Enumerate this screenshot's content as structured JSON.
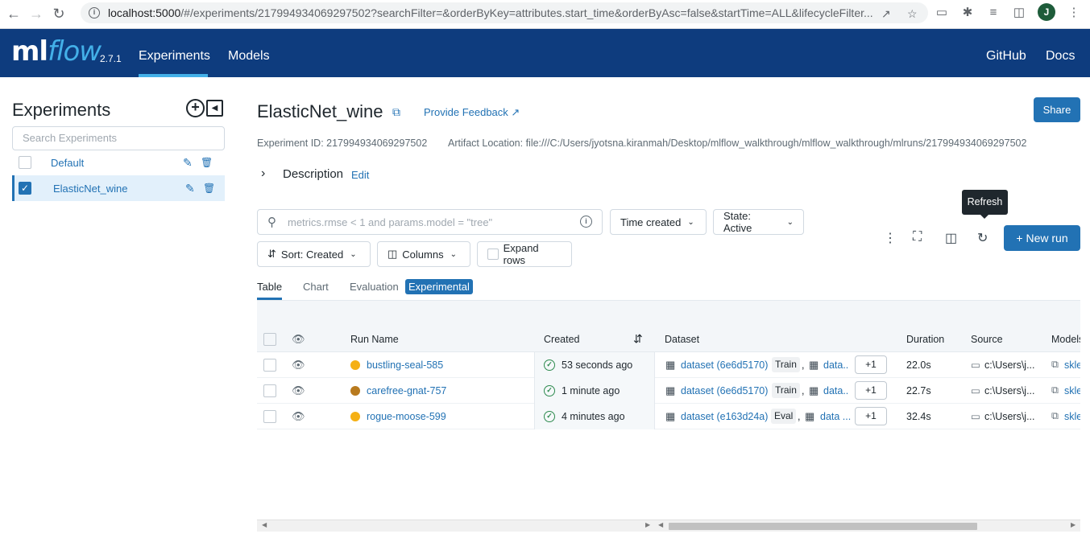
{
  "browser": {
    "url_host": "localhost:5000",
    "url_path": "/#/experiments/217994934069297502?searchFilter=&orderByKey=attributes.start_time&orderByAsc=false&startTime=ALL&lifecycleFilter...",
    "profile_initial": "J"
  },
  "header": {
    "logo_ml": "ml",
    "logo_flow": "flow",
    "version": "2.7.1",
    "nav": {
      "experiments": "Experiments",
      "models": "Models",
      "github": "GitHub",
      "docs": "Docs"
    }
  },
  "sidebar": {
    "title": "Experiments",
    "search_placeholder": "Search Experiments",
    "items": [
      {
        "label": "Default",
        "checked": false
      },
      {
        "label": "ElasticNet_wine",
        "checked": true
      }
    ]
  },
  "experiment": {
    "title": "ElasticNet_wine",
    "feedback": "Provide Feedback",
    "share": "Share",
    "id_text": "Experiment ID: 217994934069297502",
    "artifact_text": "Artifact Location: file:///C:/Users/jyotsna.kiranmah/Desktop/mlflow_walkthrough/mlflow_walkthrough/mlruns/217994934069297502",
    "description_label": "Description",
    "description_edit": "Edit"
  },
  "toolbar": {
    "search_placeholder": "metrics.rmse < 1 and params.model = \"tree\"",
    "time_created": "Time created",
    "state": "State: Active",
    "sort": "Sort: Created",
    "columns": "Columns",
    "expand_rows": "Expand rows",
    "tooltip": "Refresh",
    "new_run": "New run"
  },
  "tabs": {
    "table": "Table",
    "chart": "Chart",
    "evaluation": "Evaluation",
    "experimental": "Experimental"
  },
  "table": {
    "headers": {
      "run_name": "Run Name",
      "created": "Created",
      "dataset": "Dataset",
      "duration": "Duration",
      "source": "Source",
      "models": "Models"
    },
    "rows": [
      {
        "run_name": "bustling-seal-585",
        "color": "#f5b014",
        "created": "53 seconds ago",
        "dataset": "dataset (6e6d5170)",
        "dataset_tag": "Train",
        "dataset2": "data...",
        "plus": "+1",
        "duration": "22.0s",
        "source": "c:\\Users\\j...",
        "model": "skle"
      },
      {
        "run_name": "carefree-gnat-757",
        "color": "#b87a1e",
        "created": "1 minute ago",
        "dataset": "dataset (6e6d5170)",
        "dataset_tag": "Train",
        "dataset2": "data...",
        "plus": "+1",
        "duration": "22.7s",
        "source": "c:\\Users\\j...",
        "model": "skle"
      },
      {
        "run_name": "rogue-moose-599",
        "color": "#f5b014",
        "created": "4 minutes ago",
        "dataset": "dataset (e163d24a)",
        "dataset_tag": "Eval",
        "dataset2": "data ...",
        "plus": "+1",
        "duration": "32.4s",
        "source": "c:\\Users\\j...",
        "model": "skle"
      }
    ]
  }
}
